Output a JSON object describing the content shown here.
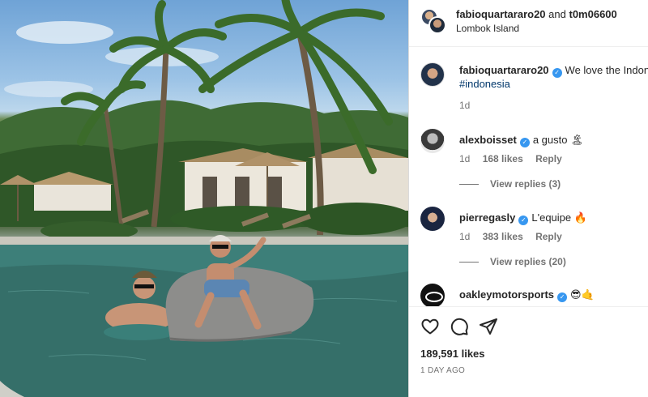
{
  "header": {
    "user1": "fabioquartararo20",
    "conjunction": "and",
    "user2": "t0m06600",
    "location": "Lombok Island"
  },
  "caption": {
    "username": "fabioquartararo20",
    "text": "We love the Indone",
    "hashtag": "#indonesia",
    "time": "1d"
  },
  "comments": [
    {
      "username": "alexboisset",
      "text": "a gusto 🏝",
      "time": "1d",
      "likes": "168 likes",
      "reply": "Reply",
      "view_replies": "View replies (3)"
    },
    {
      "username": "pierregasly",
      "text": "L'equipe 🔥",
      "time": "1d",
      "likes": "383 likes",
      "reply": "Reply",
      "view_replies": "View replies (20)"
    },
    {
      "username": "oakleymotorsports",
      "text": "😎🤙"
    }
  ],
  "actions": {
    "like_icon": "heart-icon",
    "comment_icon": "comment-icon",
    "share_icon": "share-icon",
    "likes_count": "189,591 likes",
    "posted_ago": "1 DAY AGO"
  },
  "photo": {
    "description_icon": "post-photo"
  }
}
